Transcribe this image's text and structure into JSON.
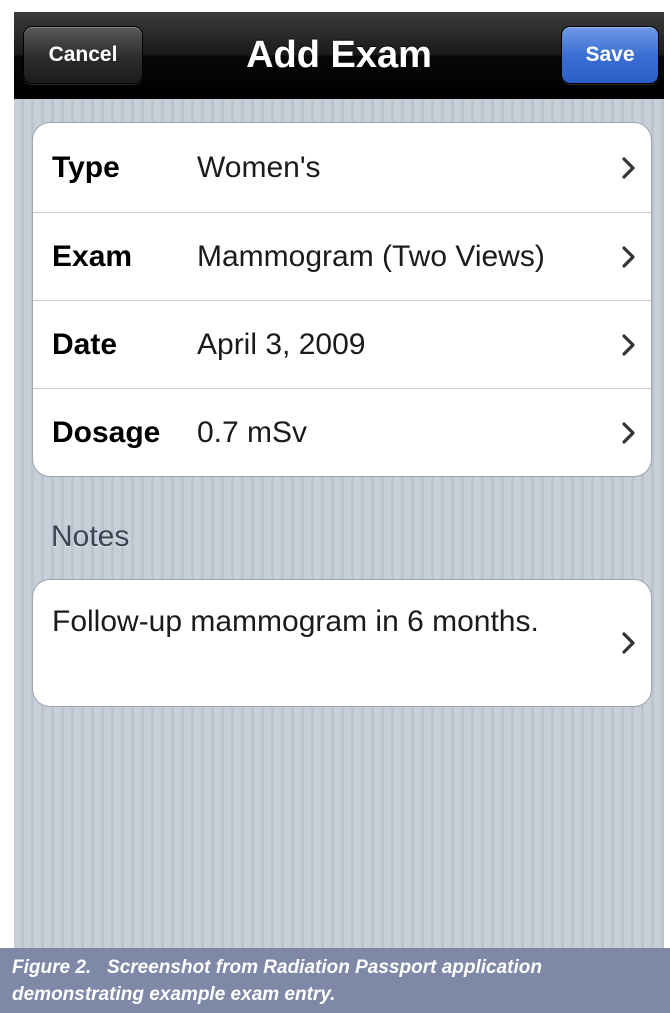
{
  "navbar": {
    "cancel_label": "Cancel",
    "title": "Add Exam",
    "save_label": "Save",
    "save_color": "#3c6fd4"
  },
  "fields": [
    {
      "label": "Type",
      "value": "Women's"
    },
    {
      "label": "Exam",
      "value": "Mammogram (Two Views)"
    },
    {
      "label": "Date",
      "value": "April 3, 2009"
    },
    {
      "label": "Dosage",
      "value": "0.7 mSv"
    }
  ],
  "notes": {
    "header": "Notes",
    "text": "Follow-up mammogram in 6 months."
  },
  "caption": "Figure 2.   Screenshot from Radiation Passport application demonstrating example exam entry.",
  "icons": {
    "row_accessory": "chevron-right-icon"
  }
}
